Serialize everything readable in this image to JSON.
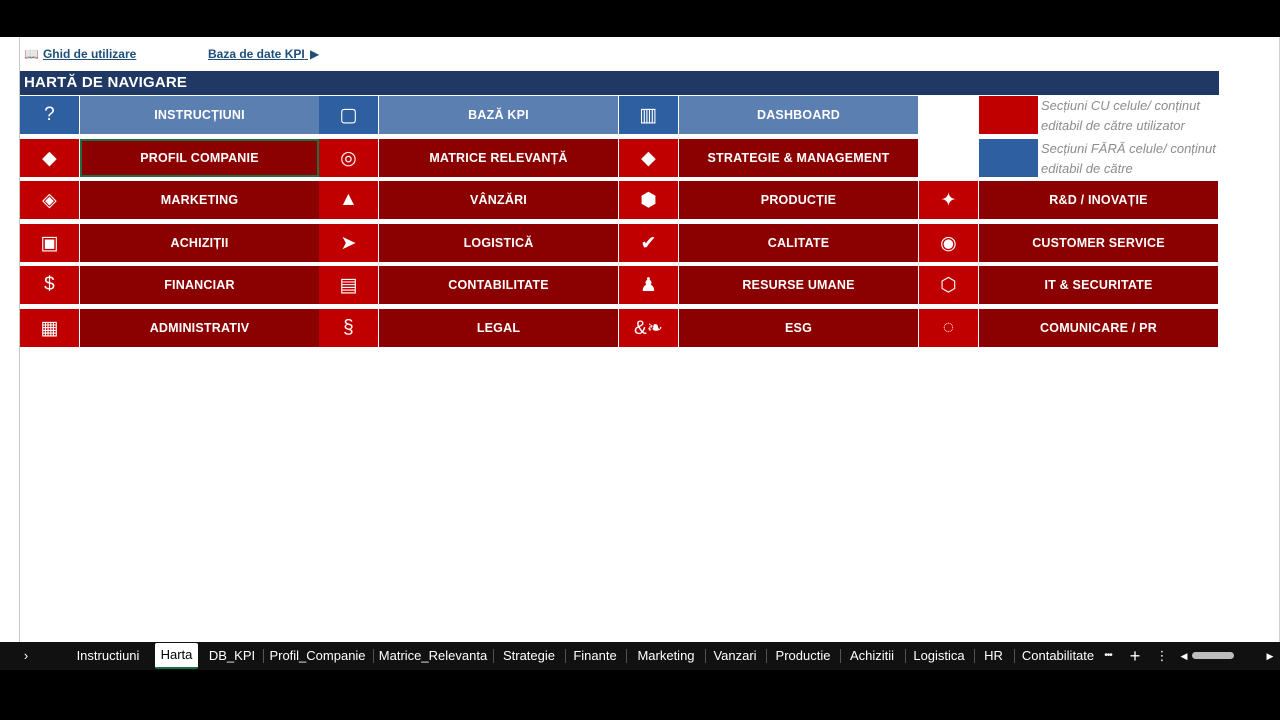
{
  "links": {
    "guide": {
      "icon": "📖",
      "label": "Ghid de utilizare"
    },
    "kpi_db": {
      "label": "Baza de date KPI",
      "arrow": "▶"
    }
  },
  "title": "HARTĂ DE NAVIGARE",
  "grid": [
    [
      {
        "icon": "?",
        "icon_name": "question-icon",
        "label": "INSTRUCȚIUNI",
        "style": "blue"
      },
      {
        "icon": "▢",
        "icon_name": "square-outline-icon",
        "label": "BAZĂ KPI",
        "style": "blue"
      },
      {
        "icon": "▥",
        "icon_name": "barcode-icon",
        "label": "DASHBOARD",
        "style": "blue"
      }
    ],
    [
      {
        "icon": "◆",
        "icon_name": "diamond-half-icon",
        "label": "PROFIL COMPANIE",
        "style": "red"
      },
      {
        "icon": "◎",
        "icon_name": "target-icon",
        "label": "MATRICE RELEVANȚĂ",
        "style": "red"
      },
      {
        "icon": "◆",
        "icon_name": "diamond-icon",
        "label": "STRATEGIE & MANAGEMENT",
        "style": "red"
      }
    ],
    [
      {
        "icon": "◈",
        "icon_name": "diamond-outline-icon",
        "label": "MARKETING",
        "style": "red"
      },
      {
        "icon": "▲",
        "icon_name": "triangle-icon",
        "label": "VÂNZĂRI",
        "style": "red"
      },
      {
        "icon": "⬢",
        "icon_name": "hexagon-icon",
        "label": "PRODUCȚIE",
        "style": "red"
      },
      {
        "icon": "✦",
        "icon_name": "four-point-star-icon",
        "label": "R&D / INOVAȚIE",
        "style": "red"
      }
    ],
    [
      {
        "icon": "▣",
        "icon_name": "square-in-square-icon",
        "label": "ACHIZIȚII",
        "style": "red"
      },
      {
        "icon": "➤",
        "icon_name": "arrow-right-icon",
        "label": "LOGISTICĂ",
        "style": "red"
      },
      {
        "icon": "✔",
        "icon_name": "checkmark-icon",
        "label": "CALITATE",
        "style": "red"
      },
      {
        "icon": "◉",
        "icon_name": "circle-dot-icon",
        "label": "CUSTOMER SERVICE",
        "style": "red"
      }
    ],
    [
      {
        "icon": "$",
        "icon_name": "dollar-icon",
        "label": "FINANCIAR",
        "style": "red"
      },
      {
        "icon": "▤",
        "icon_name": "list-lines-icon",
        "label": "CONTABILITATE",
        "style": "red"
      },
      {
        "icon": "♟",
        "icon_name": "pawn-icon",
        "label": "RESURSE UMANE",
        "style": "red"
      },
      {
        "icon": "⬡",
        "icon_name": "hexagon-outline-icon",
        "label": "IT & SECURITATE",
        "style": "red"
      }
    ],
    [
      {
        "icon": "▦",
        "icon_name": "grid-icon",
        "label": "ADMINISTRATIV",
        "style": "red"
      },
      {
        "icon": "§",
        "icon_name": "section-sign-icon",
        "label": "LEGAL",
        "style": "red"
      },
      {
        "icon": "&❧",
        "icon_name": "leaf-ampersand-icon",
        "label": "ESG",
        "style": "red"
      },
      {
        "icon": "◌",
        "icon_name": "dotted-circle-icon",
        "label": "COMUNICARE / PR",
        "style": "red"
      }
    ]
  ],
  "legend": [
    {
      "color": "#c00000",
      "text": "Secțiuni CU celule/ conținut editabil de către utilizator"
    },
    {
      "color": "#2e5fa1",
      "text": "Secțiuni FĂRĂ celule/ conținut editabil de către"
    }
  ],
  "tabs": [
    "Instructiuni",
    "Harta",
    "DB_KPI",
    "Profil_Companie",
    "Matrice_Relevanta",
    "Strategie",
    "Finante",
    "Marketing",
    "Vanzari",
    "Productie",
    "Achizitii",
    "Logistica",
    "HR",
    "Contabilitate"
  ],
  "active_tab": "Harta",
  "tabbar_icons": {
    "nav_right": "›",
    "more": "•••",
    "add": "+",
    "menu": "⋮",
    "scroll_left": "◀",
    "scroll_right": "▶"
  },
  "colors": {
    "icon_red": "#c00000",
    "label_red": "#8b0000",
    "icon_blue": "#2e5fa1",
    "label_blue": "#5b7fb0",
    "title_bar": "#1f3864"
  }
}
